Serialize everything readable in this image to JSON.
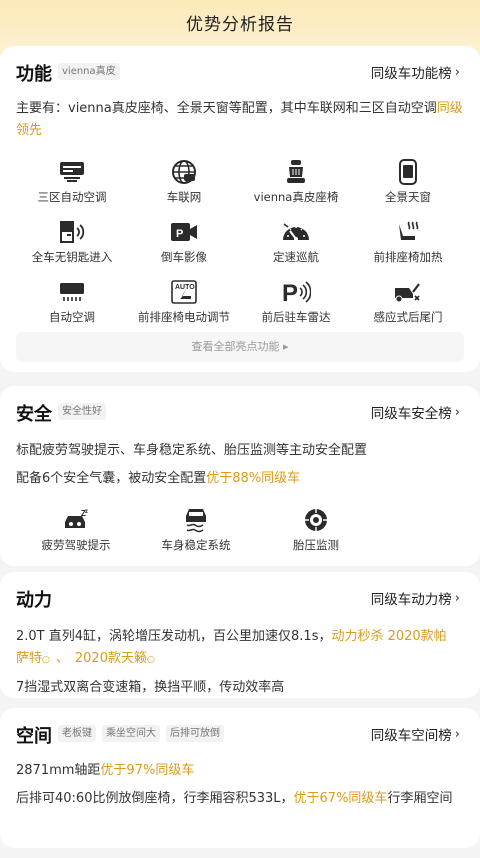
{
  "header": {
    "title": "优势分析报告"
  },
  "function": {
    "title": "功能",
    "tags": [
      "vienna真皮"
    ],
    "rank_link": "同级车功能榜",
    "summary_prefix": "主要有：vienna真皮座椅、全景天窗等配置，其中车联网和三区自动空调",
    "summary_highlight": "同级领先",
    "features": [
      {
        "label": "三区自动空调",
        "icon": "ac-panel-icon"
      },
      {
        "label": "车联网",
        "icon": "globe-car-icon"
      },
      {
        "label": "vienna真皮座椅",
        "icon": "leather-seat-icon"
      },
      {
        "label": "全景天窗",
        "icon": "sunroof-icon"
      },
      {
        "label": "全车无钥匙进入",
        "icon": "keyless-door-icon"
      },
      {
        "label": "倒车影像",
        "icon": "reverse-camera-icon"
      },
      {
        "label": "定速巡航",
        "icon": "cruise-gauge-icon"
      },
      {
        "label": "前排座椅加热",
        "icon": "seat-heat-icon"
      },
      {
        "label": "自动空调",
        "icon": "auto-ac-icon"
      },
      {
        "label": "前排座椅电动调节",
        "icon": "power-seat-icon"
      },
      {
        "label": "前后驻车雷达",
        "icon": "parking-radar-icon"
      },
      {
        "label": "感应式后尾门",
        "icon": "tailgate-icon"
      }
    ],
    "more_label": "查看全部亮点功能 ▸"
  },
  "safety": {
    "title": "安全",
    "tags": [
      "安全性好"
    ],
    "rank_link": "同级车安全榜",
    "line1": "标配疲劳驾驶提示、车身稳定系统、胎压监测等主动安全配置",
    "line2_prefix": "配备6个安全气囊，被动安全配置",
    "line2_highlight": "优于88%同级车",
    "features": [
      {
        "label": "疲劳驾驶提示",
        "icon": "fatigue-icon"
      },
      {
        "label": "车身稳定系统",
        "icon": "stability-icon"
      },
      {
        "label": "胎压监测",
        "icon": "tire-pressure-icon"
      }
    ]
  },
  "power": {
    "title": "动力",
    "rank_link": "同级车动力榜",
    "line1_prefix": "2.0T 直列4缸，涡轮增压发动机，百公里加速仅8.1s，",
    "line1_highlight": "动力秒杀 2020款帕",
    "line2_highlight_a": "萨特",
    "line2_mid": "、",
    "line2_highlight_b": "2020款天籁",
    "line3": "7挡湿式双离合变速箱，换挡平顺，传动效率高"
  },
  "space": {
    "title": "空间",
    "tags": [
      "老板键",
      "乘坐空间大",
      "后排可放倒"
    ],
    "rank_link": "同级车空间榜",
    "line1_prefix": "2871mm轴距",
    "line1_highlight": "优于97%同级车",
    "line2_prefix": "后排可40:60比例放倒座椅，行李厢容积533L，",
    "line2_highlight": "优于67%同级车",
    "line2_suffix": "行李厢空间"
  },
  "colors": {
    "accent": "#d99c1c",
    "header_gradient": "#fde9b8"
  }
}
